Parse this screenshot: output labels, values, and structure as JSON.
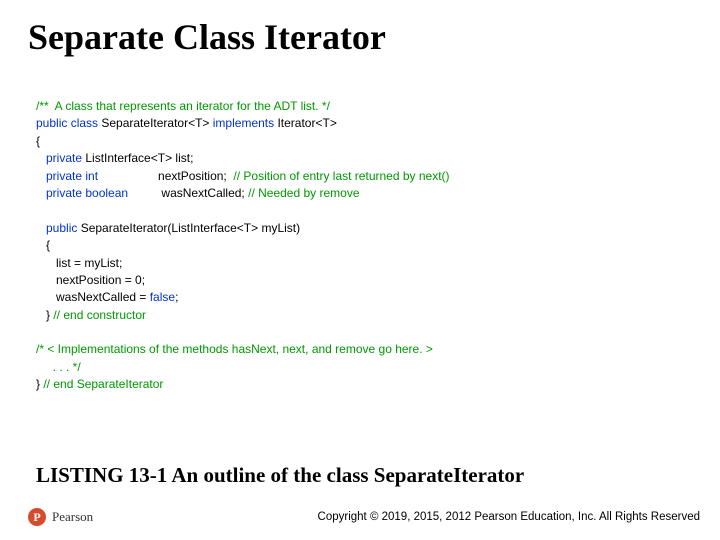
{
  "title": "Separate Class Iterator",
  "code": {
    "l1_comment": "/**  A class that represents an iterator for the ADT list. */",
    "l2a": "public class",
    "l2b": " SeparateIterator<T> ",
    "l2c": "implements",
    "l2d": " Iterator<T>",
    "l3": "{",
    "l4a": "   private",
    "l4b": " ListInterface<T> list;",
    "l5a": "   private int",
    "l5b": "                  nextPosition;  ",
    "l5c": "// Position of entry last returned by next()",
    "l6a": "   private boolean",
    "l6b": "          wasNextCalled; ",
    "l6c": "// Needed by remove",
    "blank1": " ",
    "l7a": "   public",
    "l7b": " SeparateIterator(ListInterface<T> myList)",
    "l8": "   {",
    "l9": "      list = myList;",
    "l10": "      nextPosition = 0;",
    "l11a": "      wasNextCalled = ",
    "l11b": "false",
    "l11c": ";",
    "l12a": "   } ",
    "l12b": "// end constructor",
    "blank2": " ",
    "l13": "/* < Implementations of the methods hasNext, next, and remove go here. >",
    "l14": "     . . . */",
    "l15a": "} ",
    "l15b": "// end SeparateIterator"
  },
  "caption": "LISTING 13-1 An outline of the class SeparateIterator",
  "logo": {
    "mark": "P",
    "text": "Pearson"
  },
  "copyright": "Copyright © 2019, 2015, 2012 Pearson Education, Inc. All Rights Reserved"
}
